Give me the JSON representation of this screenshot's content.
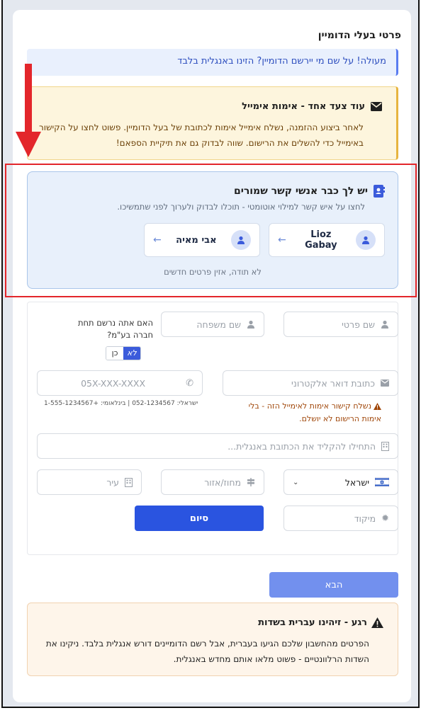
{
  "section": {
    "title": "פרטי בעלי הדומיין"
  },
  "info_banner": {
    "text": "מעולה! על שם מי יירשם הדומיין? הזינו באנגלית בלבד"
  },
  "warning": {
    "title": "עוד צעד אחד - אימות אימייל",
    "body": "לאחר ביצוע ההזמנה, נשלח אימייל אימות לכתובת של בעל הדומיין. פשוט לחצו על הקישור באימייל כדי להשלים את הרישום. שווה לבדוק גם את תיקיית הספאם!",
    "icon": "envelope-icon"
  },
  "contacts": {
    "title": "יש לך כבר אנשי קשר שמורים",
    "subtitle": "לחצו על איש קשר למילוי אוטומטי - תוכלו לבדוק ולערוך לפני שתמשיכו.",
    "items": [
      {
        "name": "Lioz Gabay"
      },
      {
        "name": "אבי מאיה"
      }
    ],
    "no_thanks": "לא תודה, אזין פרטים חדשים",
    "icon": "contact-book-icon"
  },
  "form": {
    "first_name_placeholder": "שם פרטי",
    "last_name_placeholder": "שם משפחה",
    "company_question": "האם אתה נרשם תחת חברה בע\"מ?",
    "toggle_no": "לא",
    "toggle_yes": "כן",
    "email_placeholder": "כתובת דואר אלקטרוני",
    "phone_placeholder": "05X-XXX-XXXX",
    "phone_help": "ישראלי: 052-1234567 | בינלאומי: +1-555-1234567",
    "email_warning": "נשלח קישור אימות לאימייל הזה - בלי אימות הרישום לא יושלם.",
    "address_placeholder": "התחילו להקליד את הכתובת באנגלית...",
    "country_value": "ישראל",
    "region_placeholder": "מחוז/אזור",
    "city_placeholder": "עיר",
    "zip_placeholder": "מיקוד",
    "finish_label": "סיום"
  },
  "next_label": "הבא",
  "hebrew_notice": {
    "title": "רגע - זיהינו עברית בשדות",
    "body": "הפרטים מהחשבון שלכם הגיעו בעברית, אבל רשם הדומיינים דורש אנגלית בלבד. ניקינו את השדות הרלוונטיים - פשוט מלאו אותם מחדש באנגלית."
  },
  "colors": {
    "primary": "#2a54e0",
    "annotation": "#e3262b"
  }
}
